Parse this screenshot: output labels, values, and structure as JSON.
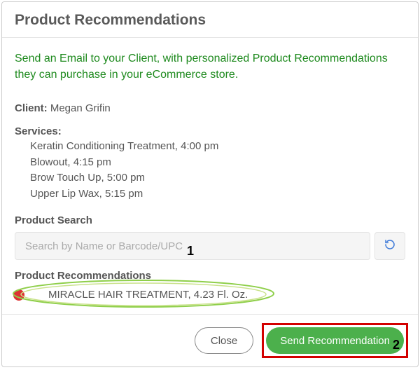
{
  "dialog": {
    "title": "Product Recommendations",
    "intro": "Send an Email to your Client, with personalized Product Recommendations they can purchase in your eCommerce store."
  },
  "client": {
    "label": "Client:",
    "name": "Megan Grifin"
  },
  "services": {
    "label": "Services:",
    "items": [
      "Keratin Conditioning Treatment, 4:00 pm",
      "Blowout, 4:15 pm",
      "Brow Touch Up, 5:00 pm",
      "Upper Lip Wax, 5:15 pm"
    ]
  },
  "search": {
    "label": "Product Search",
    "placeholder": "Search by Name or Barcode/UPC",
    "value": ""
  },
  "recommendations": {
    "label": "Product Recommendations",
    "items": [
      {
        "name": "MIRACLE HAIR TREATMENT, 4.23 Fl. Oz."
      }
    ]
  },
  "footer": {
    "close": "Close",
    "send": "Send Recommendation"
  },
  "annotations": {
    "num1": "1",
    "num2": "2"
  }
}
